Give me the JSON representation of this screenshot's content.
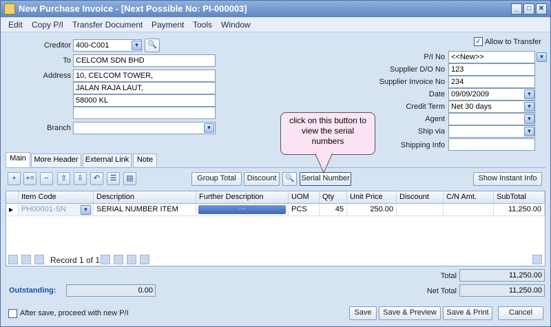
{
  "window": {
    "title": "New Purchase Invoice - [Next Possible No: PI-000003]"
  },
  "menu": [
    "Edit",
    "Copy P/I",
    "Transfer Document",
    "Payment",
    "Tools",
    "Window"
  ],
  "header": {
    "creditor_label": "Creditor",
    "creditor_value": "400-C001",
    "to_label": "To",
    "to_value": "CELCOM SDN BHD",
    "address_label": "Address",
    "address_lines": [
      "10, CELCOM TOWER,",
      "JALAN RAJA LAUT,",
      "58000 KL",
      ""
    ],
    "branch_label": "Branch",
    "branch_value": ""
  },
  "right_fields": {
    "allow_transfer": "Allow to Transfer",
    "pi_no_label": "P/I No",
    "pi_no_value": "<<New>>",
    "supplier_do_label": "Supplier D/O No",
    "supplier_do_value": "123",
    "supplier_inv_label": "Supplier Invoice No",
    "supplier_inv_value": "234",
    "date_label": "Date",
    "date_value": "09/09/2009",
    "credit_term_label": "Credit Term",
    "credit_term_value": "Net 30 days",
    "agent_label": "Agent",
    "agent_value": "",
    "ship_via_label": "Ship via",
    "ship_via_value": "",
    "shipping_info_label": "Shipping Info",
    "shipping_info_value": ""
  },
  "callout": {
    "text": "click on this button to view the serial numbers"
  },
  "tabs": [
    "Main",
    "More Header",
    "External Link",
    "Note"
  ],
  "toolbar": {
    "group_total": "Group Total",
    "discount": "Discount",
    "serial_number": "Serial Number",
    "show_instant_info": "Show Instant Info",
    "icons": [
      "add-icon",
      "insert-icon",
      "delete-icon",
      "move-up-icon",
      "move-down-icon",
      "undo-icon",
      "list-icon",
      "detail-icon"
    ]
  },
  "grid": {
    "columns": [
      "Item Code",
      "Description",
      "Further Description",
      "UOM",
      "Qty",
      "Unit Price",
      "Discount",
      "C/N Amt.",
      "SubTotal"
    ],
    "rows": [
      {
        "item_code": "PH00001-SN",
        "description": "SERIAL NUMBER ITEM",
        "further_description": "···",
        "uom": "PCS",
        "qty": "45",
        "unit_price": "250.00",
        "discount": "",
        "cn_amt": "",
        "subtotal": "11,250.00"
      }
    ],
    "record_text": "Record 1 of 1"
  },
  "totals": {
    "total_label": "Total",
    "total_value": "11,250.00",
    "net_total_label": "Net Total",
    "net_total_value": "11,250.00"
  },
  "outstanding": {
    "label": "Outstanding:",
    "value": "0.00"
  },
  "footer": {
    "after_save": "After save, proceed with new P/I",
    "save": "Save",
    "save_preview": "Save & Preview",
    "save_print": "Save & Print",
    "cancel": "Cancel"
  },
  "colors": {
    "title_bar": "#5f86c2",
    "window_bg": "#d6e3f3",
    "callout_bg": "#fde3f3",
    "outstanding_label": "#1f4fa0"
  }
}
